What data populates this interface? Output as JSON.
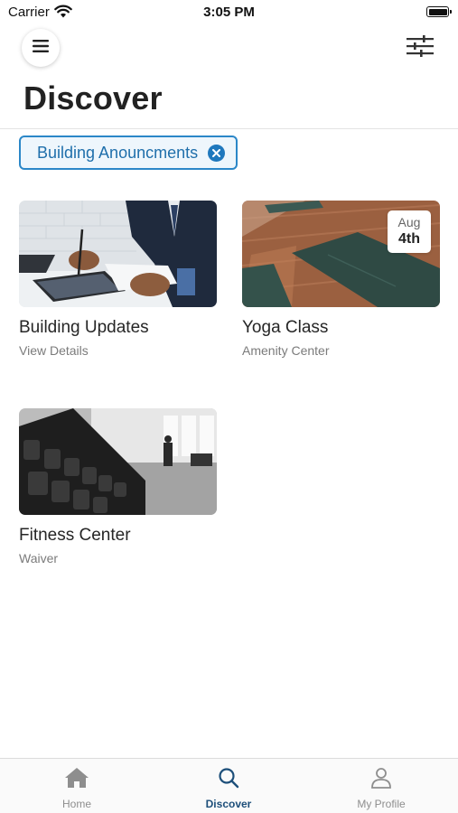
{
  "status_bar": {
    "carrier": "Carrier",
    "time": "3:05 PM"
  },
  "header": {
    "title": "Discover",
    "menu_icon": "hamburger-menu-icon",
    "filter_icon": "sliders-icon"
  },
  "filter_chip": {
    "label": "Building Anouncments",
    "close_icon": "close-circle-icon"
  },
  "cards": [
    {
      "title": "Building Updates",
      "subtitle": "View Details"
    },
    {
      "title": "Yoga Class",
      "subtitle": "Amenity Center",
      "badge": {
        "month": "Aug",
        "day": "4th"
      }
    },
    {
      "title": "Fitness Center",
      "subtitle": "Waiver"
    }
  ],
  "tab_bar": {
    "tabs": [
      {
        "label": "Home",
        "icon": "home-icon",
        "active": false
      },
      {
        "label": "Discover",
        "icon": "search-icon",
        "active": true
      },
      {
        "label": "My Profile",
        "icon": "user-icon",
        "active": false
      }
    ]
  },
  "colors": {
    "accent": "#2B87C8",
    "chip_text": "#1F6FAB",
    "active_tab": "#1D4F7A",
    "inactive_tab": "#8E8E8E"
  }
}
